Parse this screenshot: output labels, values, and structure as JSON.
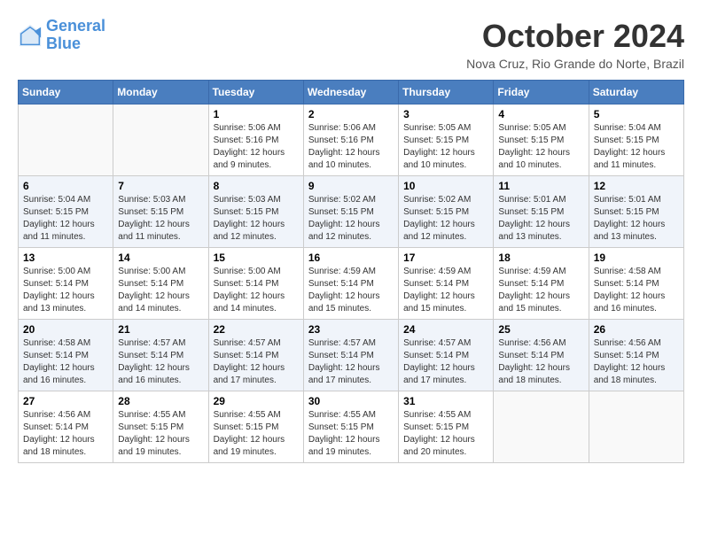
{
  "header": {
    "logo_line1": "General",
    "logo_line2": "Blue",
    "month_title": "October 2024",
    "location": "Nova Cruz, Rio Grande do Norte, Brazil"
  },
  "weekdays": [
    "Sunday",
    "Monday",
    "Tuesday",
    "Wednesday",
    "Thursday",
    "Friday",
    "Saturday"
  ],
  "weeks": [
    [
      {
        "day": "",
        "sunrise": "",
        "sunset": "",
        "daylight": ""
      },
      {
        "day": "",
        "sunrise": "",
        "sunset": "",
        "daylight": ""
      },
      {
        "day": "1",
        "sunrise": "Sunrise: 5:06 AM",
        "sunset": "Sunset: 5:16 PM",
        "daylight": "Daylight: 12 hours and 9 minutes."
      },
      {
        "day": "2",
        "sunrise": "Sunrise: 5:06 AM",
        "sunset": "Sunset: 5:16 PM",
        "daylight": "Daylight: 12 hours and 10 minutes."
      },
      {
        "day": "3",
        "sunrise": "Sunrise: 5:05 AM",
        "sunset": "Sunset: 5:15 PM",
        "daylight": "Daylight: 12 hours and 10 minutes."
      },
      {
        "day": "4",
        "sunrise": "Sunrise: 5:05 AM",
        "sunset": "Sunset: 5:15 PM",
        "daylight": "Daylight: 12 hours and 10 minutes."
      },
      {
        "day": "5",
        "sunrise": "Sunrise: 5:04 AM",
        "sunset": "Sunset: 5:15 PM",
        "daylight": "Daylight: 12 hours and 11 minutes."
      }
    ],
    [
      {
        "day": "6",
        "sunrise": "Sunrise: 5:04 AM",
        "sunset": "Sunset: 5:15 PM",
        "daylight": "Daylight: 12 hours and 11 minutes."
      },
      {
        "day": "7",
        "sunrise": "Sunrise: 5:03 AM",
        "sunset": "Sunset: 5:15 PM",
        "daylight": "Daylight: 12 hours and 11 minutes."
      },
      {
        "day": "8",
        "sunrise": "Sunrise: 5:03 AM",
        "sunset": "Sunset: 5:15 PM",
        "daylight": "Daylight: 12 hours and 12 minutes."
      },
      {
        "day": "9",
        "sunrise": "Sunrise: 5:02 AM",
        "sunset": "Sunset: 5:15 PM",
        "daylight": "Daylight: 12 hours and 12 minutes."
      },
      {
        "day": "10",
        "sunrise": "Sunrise: 5:02 AM",
        "sunset": "Sunset: 5:15 PM",
        "daylight": "Daylight: 12 hours and 12 minutes."
      },
      {
        "day": "11",
        "sunrise": "Sunrise: 5:01 AM",
        "sunset": "Sunset: 5:15 PM",
        "daylight": "Daylight: 12 hours and 13 minutes."
      },
      {
        "day": "12",
        "sunrise": "Sunrise: 5:01 AM",
        "sunset": "Sunset: 5:15 PM",
        "daylight": "Daylight: 12 hours and 13 minutes."
      }
    ],
    [
      {
        "day": "13",
        "sunrise": "Sunrise: 5:00 AM",
        "sunset": "Sunset: 5:14 PM",
        "daylight": "Daylight: 12 hours and 13 minutes."
      },
      {
        "day": "14",
        "sunrise": "Sunrise: 5:00 AM",
        "sunset": "Sunset: 5:14 PM",
        "daylight": "Daylight: 12 hours and 14 minutes."
      },
      {
        "day": "15",
        "sunrise": "Sunrise: 5:00 AM",
        "sunset": "Sunset: 5:14 PM",
        "daylight": "Daylight: 12 hours and 14 minutes."
      },
      {
        "day": "16",
        "sunrise": "Sunrise: 4:59 AM",
        "sunset": "Sunset: 5:14 PM",
        "daylight": "Daylight: 12 hours and 15 minutes."
      },
      {
        "day": "17",
        "sunrise": "Sunrise: 4:59 AM",
        "sunset": "Sunset: 5:14 PM",
        "daylight": "Daylight: 12 hours and 15 minutes."
      },
      {
        "day": "18",
        "sunrise": "Sunrise: 4:59 AM",
        "sunset": "Sunset: 5:14 PM",
        "daylight": "Daylight: 12 hours and 15 minutes."
      },
      {
        "day": "19",
        "sunrise": "Sunrise: 4:58 AM",
        "sunset": "Sunset: 5:14 PM",
        "daylight": "Daylight: 12 hours and 16 minutes."
      }
    ],
    [
      {
        "day": "20",
        "sunrise": "Sunrise: 4:58 AM",
        "sunset": "Sunset: 5:14 PM",
        "daylight": "Daylight: 12 hours and 16 minutes."
      },
      {
        "day": "21",
        "sunrise": "Sunrise: 4:57 AM",
        "sunset": "Sunset: 5:14 PM",
        "daylight": "Daylight: 12 hours and 16 minutes."
      },
      {
        "day": "22",
        "sunrise": "Sunrise: 4:57 AM",
        "sunset": "Sunset: 5:14 PM",
        "daylight": "Daylight: 12 hours and 17 minutes."
      },
      {
        "day": "23",
        "sunrise": "Sunrise: 4:57 AM",
        "sunset": "Sunset: 5:14 PM",
        "daylight": "Daylight: 12 hours and 17 minutes."
      },
      {
        "day": "24",
        "sunrise": "Sunrise: 4:57 AM",
        "sunset": "Sunset: 5:14 PM",
        "daylight": "Daylight: 12 hours and 17 minutes."
      },
      {
        "day": "25",
        "sunrise": "Sunrise: 4:56 AM",
        "sunset": "Sunset: 5:14 PM",
        "daylight": "Daylight: 12 hours and 18 minutes."
      },
      {
        "day": "26",
        "sunrise": "Sunrise: 4:56 AM",
        "sunset": "Sunset: 5:14 PM",
        "daylight": "Daylight: 12 hours and 18 minutes."
      }
    ],
    [
      {
        "day": "27",
        "sunrise": "Sunrise: 4:56 AM",
        "sunset": "Sunset: 5:14 PM",
        "daylight": "Daylight: 12 hours and 18 minutes."
      },
      {
        "day": "28",
        "sunrise": "Sunrise: 4:55 AM",
        "sunset": "Sunset: 5:15 PM",
        "daylight": "Daylight: 12 hours and 19 minutes."
      },
      {
        "day": "29",
        "sunrise": "Sunrise: 4:55 AM",
        "sunset": "Sunset: 5:15 PM",
        "daylight": "Daylight: 12 hours and 19 minutes."
      },
      {
        "day": "30",
        "sunrise": "Sunrise: 4:55 AM",
        "sunset": "Sunset: 5:15 PM",
        "daylight": "Daylight: 12 hours and 19 minutes."
      },
      {
        "day": "31",
        "sunrise": "Sunrise: 4:55 AM",
        "sunset": "Sunset: 5:15 PM",
        "daylight": "Daylight: 12 hours and 20 minutes."
      },
      {
        "day": "",
        "sunrise": "",
        "sunset": "",
        "daylight": ""
      },
      {
        "day": "",
        "sunrise": "",
        "sunset": "",
        "daylight": ""
      }
    ]
  ]
}
